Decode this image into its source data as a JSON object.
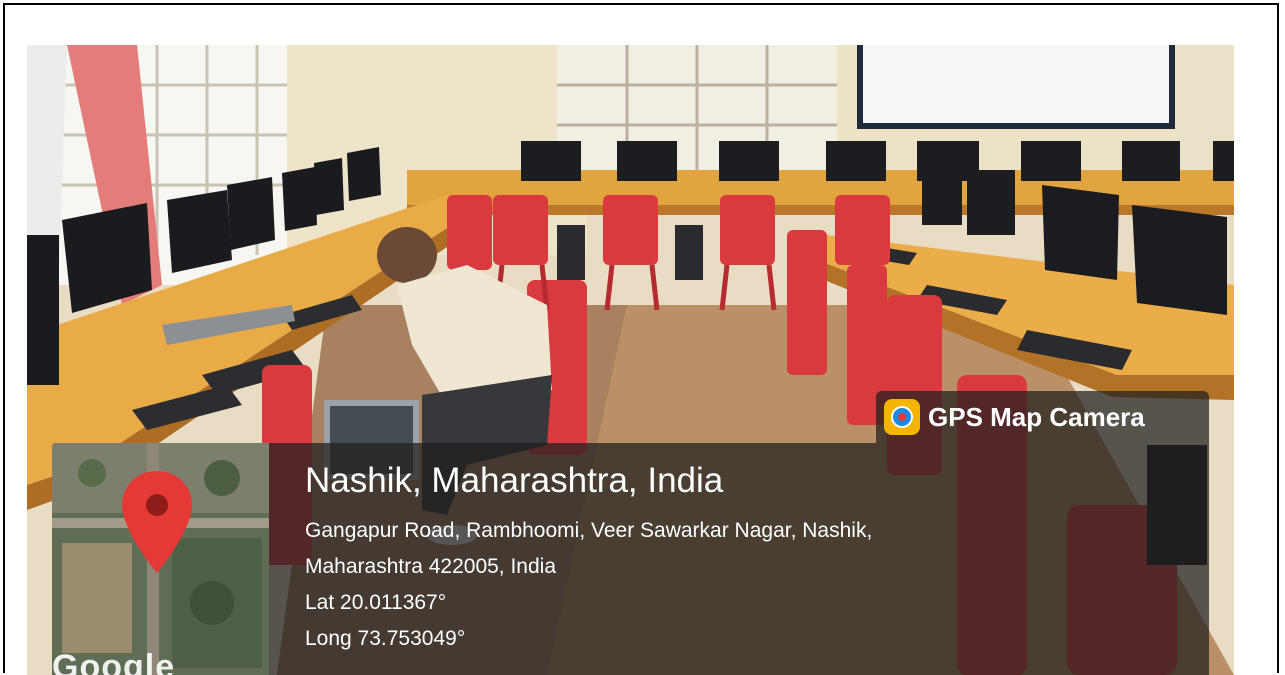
{
  "overlay": {
    "app_name": "GPS Map Camera",
    "place": "Nashik, Maharashtra, India",
    "address_line1": "Gangapur Road, Rambhoomi, Veer Sawarkar Nagar, Nashik,",
    "address_line2": "Maharashtra 422005, India",
    "latitude": "Lat 20.011367°",
    "longitude": "Long 73.753049°",
    "map_watermark": "Google"
  },
  "icons": {
    "app_icon": "gps-map-camera-icon",
    "map_pin": "location-pin-icon"
  },
  "colors": {
    "chair_red": "#d93a3f",
    "desk_yellow": "#e7a43b",
    "pin_red": "#e53935",
    "overlay_bg": "#1e1e1e"
  }
}
